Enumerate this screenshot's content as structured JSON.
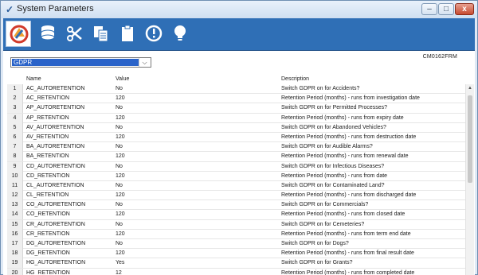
{
  "window": {
    "title": "System Parameters",
    "buttons": {
      "minimize": "–",
      "maximize": "□",
      "close": "x"
    }
  },
  "toolbar": {
    "icons": [
      "refresh-icon",
      "database-icon",
      "scissors-icon",
      "copy-icon",
      "clipboard-icon",
      "info-icon",
      "lightbulb-icon"
    ]
  },
  "filter": {
    "selected": "GDPR",
    "arrow": "⌵"
  },
  "form_code": "CM0162FRM",
  "table": {
    "headers": {
      "name": "Name",
      "value": "Value",
      "description": "Description"
    },
    "rows": [
      {
        "n": "1",
        "name": "AC_AUTORETENTION",
        "value": "No",
        "desc": "Switch GDPR on for Accidents?"
      },
      {
        "n": "2",
        "name": "AC_RETENTION",
        "value": "120",
        "desc": "Retention Period (months) - runs from investigation date"
      },
      {
        "n": "3",
        "name": "AP_AUTORETENTION",
        "value": "No",
        "desc": "Switch GDPR on for Permitted Processes?"
      },
      {
        "n": "4",
        "name": "AP_RETENTION",
        "value": "120",
        "desc": "Retention Period (months) - runs from expiry date"
      },
      {
        "n": "5",
        "name": "AV_AUTORETENTION",
        "value": "No",
        "desc": "Switch GDPR on for Abandoned Vehicles?"
      },
      {
        "n": "6",
        "name": "AV_RETENTION",
        "value": "120",
        "desc": "Retention Period (months) - runs from destruction date"
      },
      {
        "n": "7",
        "name": "BA_AUTORETENTION",
        "value": "No",
        "desc": "Switch GDPR on for Audible Alarms?"
      },
      {
        "n": "8",
        "name": "BA_RETENTION",
        "value": "120",
        "desc": "Retention Period (months) - runs from renewal date"
      },
      {
        "n": "9",
        "name": "CD_AUTORETENTION",
        "value": "No",
        "desc": "Switch GDPR on for Infectious Diseases?"
      },
      {
        "n": "10",
        "name": "CD_RETENTION",
        "value": "120",
        "desc": "Retention Period (months) - runs from date"
      },
      {
        "n": "11",
        "name": "CL_AUTORETENTION",
        "value": "No",
        "desc": "Switch GDPR on for Contaminated Land?"
      },
      {
        "n": "12",
        "name": "CL_RETENTION",
        "value": "120",
        "desc": "Retention Period (months) - runs from discharged date"
      },
      {
        "n": "13",
        "name": "CO_AUTORETENTION",
        "value": "No",
        "desc": "Switch GDPR on for Commercials?"
      },
      {
        "n": "14",
        "name": "CO_RETENTION",
        "value": "120",
        "desc": "Retention Period (months) - runs from closed date"
      },
      {
        "n": "15",
        "name": "CR_AUTORETENTION",
        "value": "No",
        "desc": "Switch GDPR on for Cemeteries?"
      },
      {
        "n": "16",
        "name": "CR_RETENTION",
        "value": "120",
        "desc": "Retention Period (months) - runs from term end date"
      },
      {
        "n": "17",
        "name": "DG_AUTORETENTION",
        "value": "No",
        "desc": "Switch GDPR on for Dogs?"
      },
      {
        "n": "18",
        "name": "DG_RETENTION",
        "value": "120",
        "desc": "Retention Period (months) - runs from final result date"
      },
      {
        "n": "19",
        "name": "HG_AUTORETENTION",
        "value": "Yes",
        "desc": "Switch GDPR on for Grants?"
      },
      {
        "n": "20",
        "name": "HG_RETENTION",
        "value": "12",
        "desc": "Retention Period (months) - runs from completed date"
      }
    ]
  }
}
